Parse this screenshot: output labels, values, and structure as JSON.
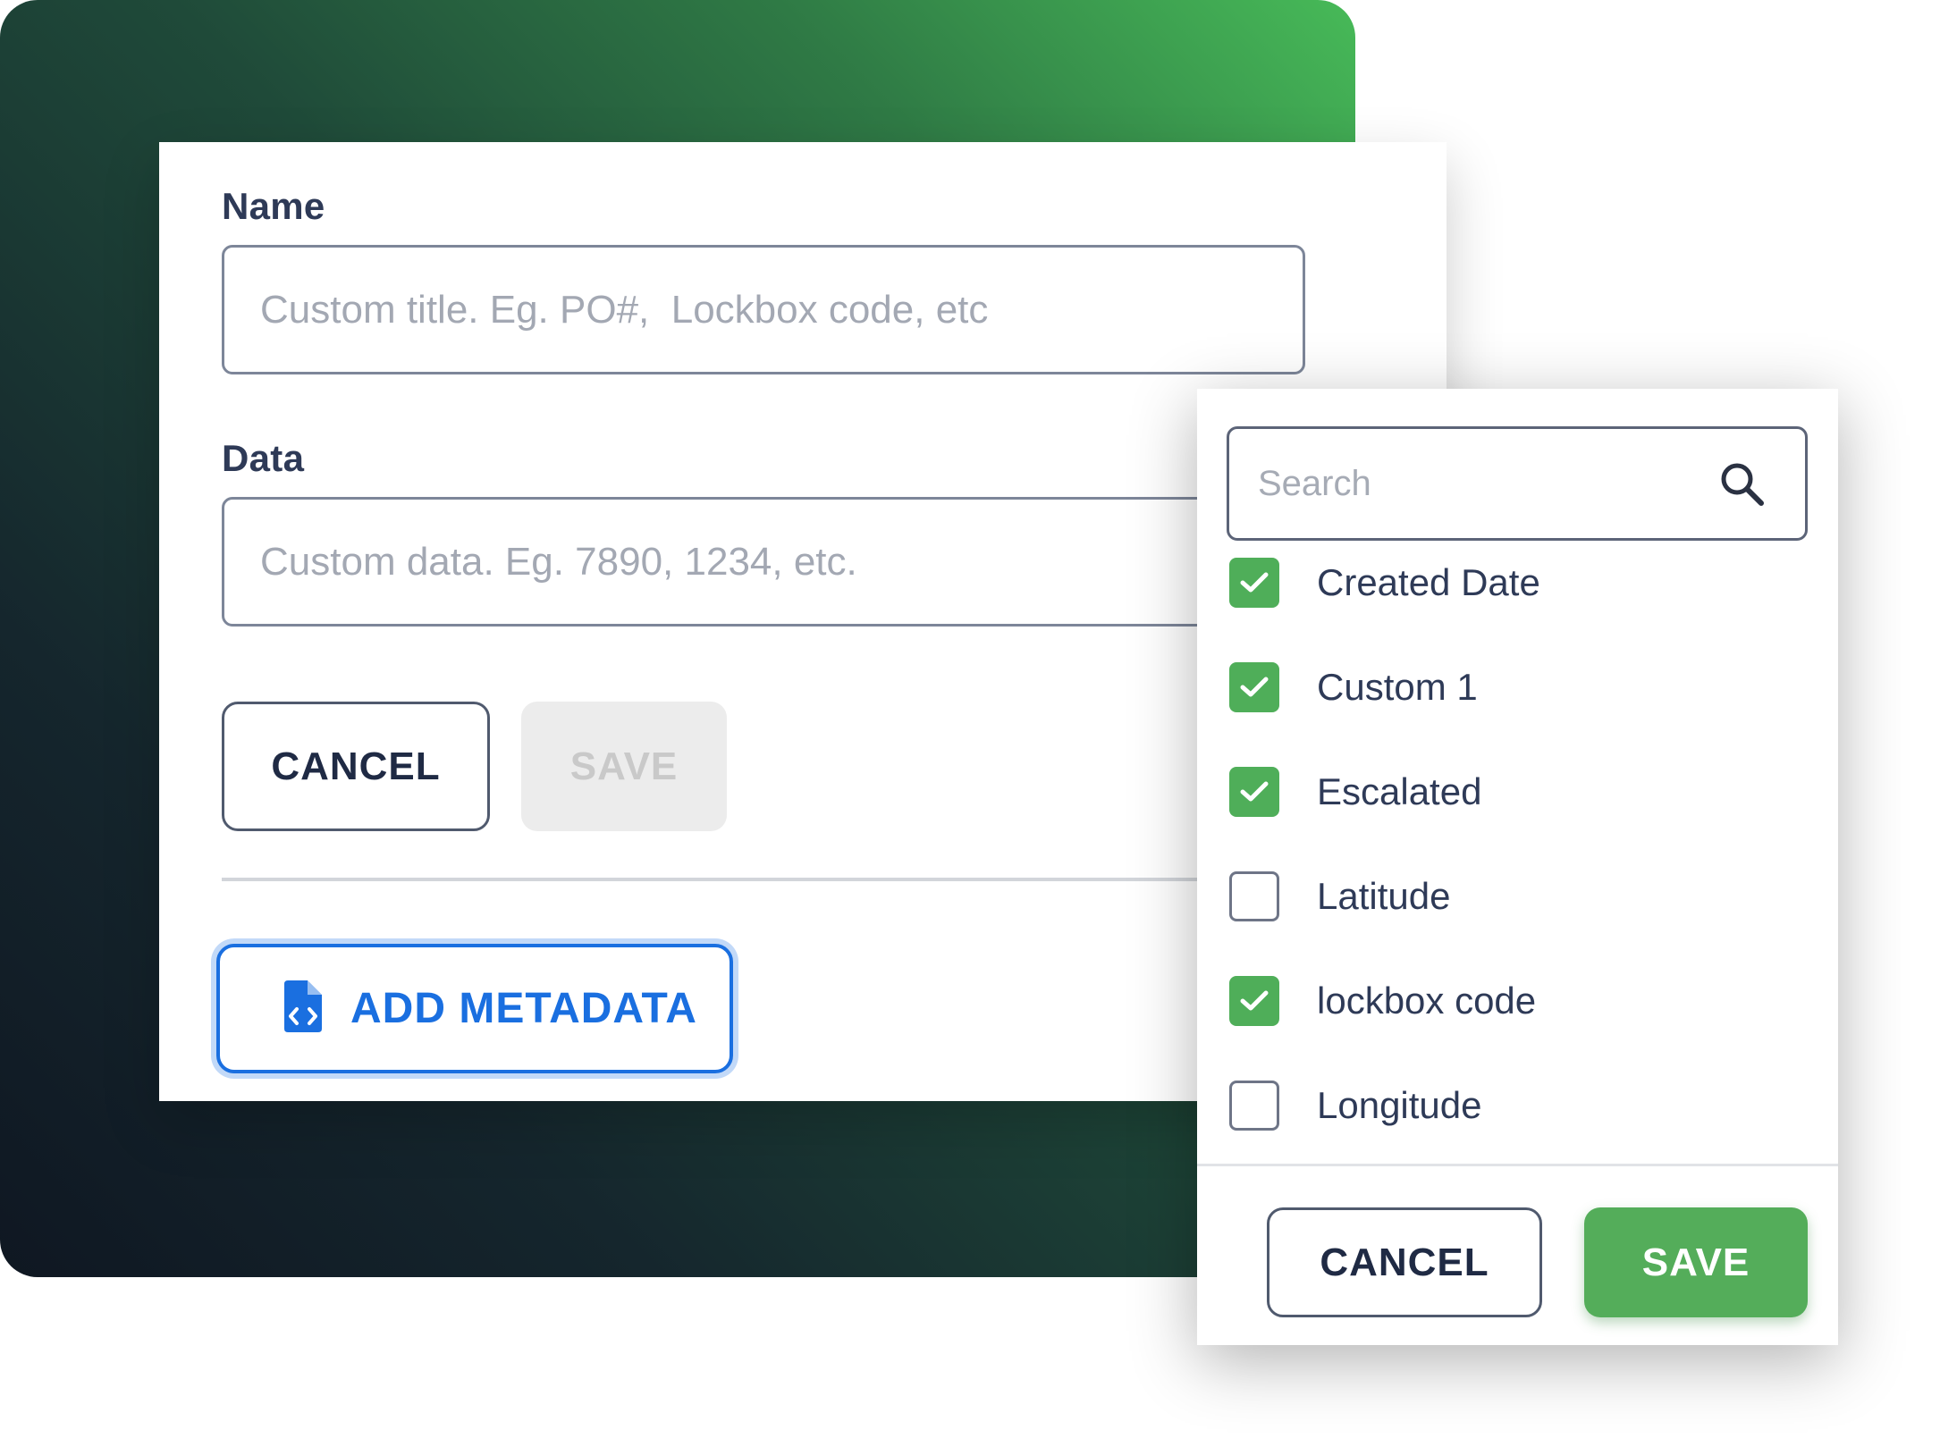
{
  "form": {
    "name": {
      "label": "Name",
      "value": "",
      "placeholder": "Custom title. Eg. PO#,  Lockbox code, etc"
    },
    "data": {
      "label": "Data",
      "value": "",
      "placeholder": "Custom data. Eg. 7890, 1234, etc."
    },
    "cancel_label": "CANCEL",
    "save_label": "SAVE",
    "add_metadata_label": "ADD METADATA"
  },
  "dropdown": {
    "search": {
      "placeholder": "Search",
      "value": ""
    },
    "options": [
      {
        "label": "Created Date",
        "checked": true
      },
      {
        "label": "Custom 1",
        "checked": true
      },
      {
        "label": "Escalated",
        "checked": true
      },
      {
        "label": "Latitude",
        "checked": false
      },
      {
        "label": "lockbox code",
        "checked": true
      },
      {
        "label": "Longitude",
        "checked": false
      }
    ],
    "cancel_label": "CANCEL",
    "save_label": "SAVE"
  },
  "colors": {
    "accent_green": "#54ad5a",
    "link_blue": "#1a6fe0",
    "text_dark": "#2e3a57"
  },
  "icons": {
    "search": "search-icon",
    "checkbox_check": "check-icon",
    "add_metadata": "file-code-icon"
  }
}
